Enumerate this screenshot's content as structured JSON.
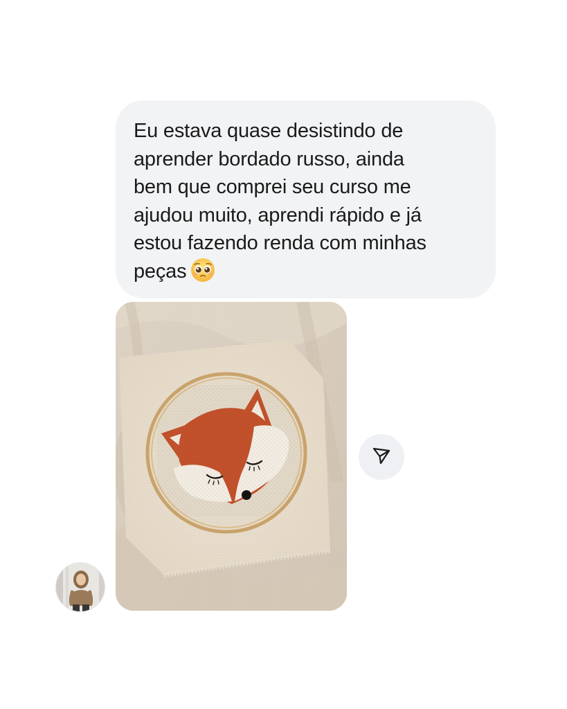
{
  "message": {
    "lines": [
      "Eu estava quase desistindo de",
      "aprender bordado russo, ainda",
      "bem que comprei seu curso me",
      "ajudou muito, aprendi rápido e já",
      "estou fazendo renda com minhas",
      "peças"
    ],
    "emoji_icon": "pleading-face-emoji"
  },
  "attachment": {
    "type": "photo",
    "subject": "fox-embroidery-hoop"
  },
  "actions": {
    "share_icon": "paper-plane-icon"
  },
  "sender": {
    "avatar_icon": "user-avatar"
  },
  "colors": {
    "bubble_bg": "#f2f3f5",
    "text": "#1a1a1a",
    "share_bg": "#eef0f3",
    "fox_orange": "#c4522c"
  }
}
